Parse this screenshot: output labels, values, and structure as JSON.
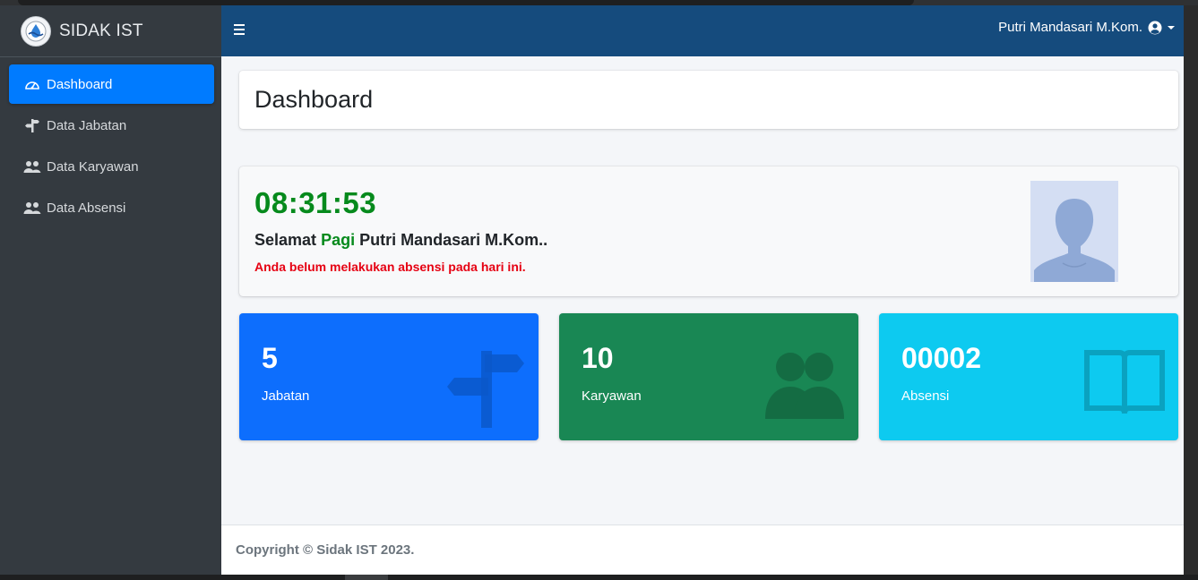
{
  "app": {
    "brand": "SIDAK IST"
  },
  "sidebar": {
    "items": [
      {
        "label": "Dashboard",
        "icon": "gauge-icon",
        "active": true
      },
      {
        "label": "Data Jabatan",
        "icon": "signpost-icon",
        "active": false
      },
      {
        "label": "Data Karyawan",
        "icon": "users-icon",
        "active": false
      },
      {
        "label": "Data Absensi",
        "icon": "users-icon",
        "active": false
      }
    ]
  },
  "header": {
    "user_name": "Putri Mandasari M.Kom."
  },
  "page": {
    "title": "Dashboard"
  },
  "welcome": {
    "clock": "08:31:53",
    "greeting_prefix": "Selamat",
    "greeting_time": "Pagi",
    "greeting_name": "Putri Mandasari M.Kom..",
    "notice": "Anda belum melakukan absensi pada hari ini."
  },
  "stats": [
    {
      "value": "5",
      "label": "Jabatan",
      "color": "#0d6efd",
      "icon": "signpost-icon"
    },
    {
      "value": "10",
      "label": "Karyawan",
      "color": "#198754",
      "icon": "users-icon"
    },
    {
      "value": "00002",
      "label": "Absensi",
      "color": "#0dcaf0",
      "icon": "book-open-icon"
    }
  ],
  "footer": {
    "copyright": "Copyright © Sidak IST 2023."
  },
  "colors": {
    "topbar": "#154b7d",
    "sidebar": "#343a40",
    "active": "#007bff",
    "clock": "#068a1c",
    "notice": "#e60012"
  }
}
